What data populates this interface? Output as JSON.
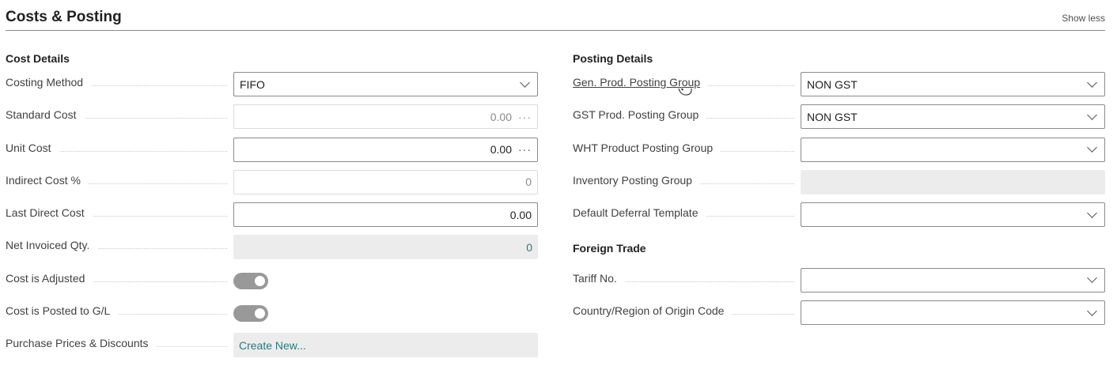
{
  "header": {
    "title": "Costs & Posting",
    "show_less": "Show less"
  },
  "cost_details": {
    "title": "Cost Details",
    "costing_method": {
      "label": "Costing Method",
      "value": "FIFO"
    },
    "standard_cost": {
      "label": "Standard Cost",
      "value": "0.00"
    },
    "unit_cost": {
      "label": "Unit Cost",
      "value": "0.00"
    },
    "indirect_cost": {
      "label": "Indirect Cost %",
      "value": "0"
    },
    "last_direct_cost": {
      "label": "Last Direct Cost",
      "value": "0.00"
    },
    "net_invoiced_qty": {
      "label": "Net Invoiced Qty.",
      "value": "0"
    },
    "cost_is_adjusted": {
      "label": "Cost is Adjusted",
      "on": true
    },
    "cost_is_posted": {
      "label": "Cost is Posted to G/L",
      "on": true
    },
    "purchase_prices": {
      "label": "Purchase Prices & Discounts",
      "value": "Create New..."
    }
  },
  "posting_details": {
    "title": "Posting Details",
    "gen_prod_posting_group": {
      "label": "Gen. Prod. Posting Group",
      "value": "NON GST"
    },
    "gst_prod_posting_group": {
      "label": "GST Prod. Posting Group",
      "value": "NON GST"
    },
    "wht_product_posting_group": {
      "label": "WHT Product Posting Group",
      "value": ""
    },
    "inventory_posting_group": {
      "label": "Inventory Posting Group",
      "value": ""
    },
    "default_deferral_template": {
      "label": "Default Deferral Template",
      "value": ""
    }
  },
  "foreign_trade": {
    "title": "Foreign Trade",
    "tariff_no": {
      "label": "Tariff No.",
      "value": ""
    },
    "country_region": {
      "label": "Country/Region of Origin Code",
      "value": ""
    }
  },
  "colors": {
    "accent": "#277c7c",
    "toggle_on": "#999999",
    "readonly_bg": "#ececec"
  },
  "icons": {
    "dropdown": "chevron-down-icon",
    "more": "ellipsis-icon",
    "cursor": "hand-pointer-icon"
  }
}
